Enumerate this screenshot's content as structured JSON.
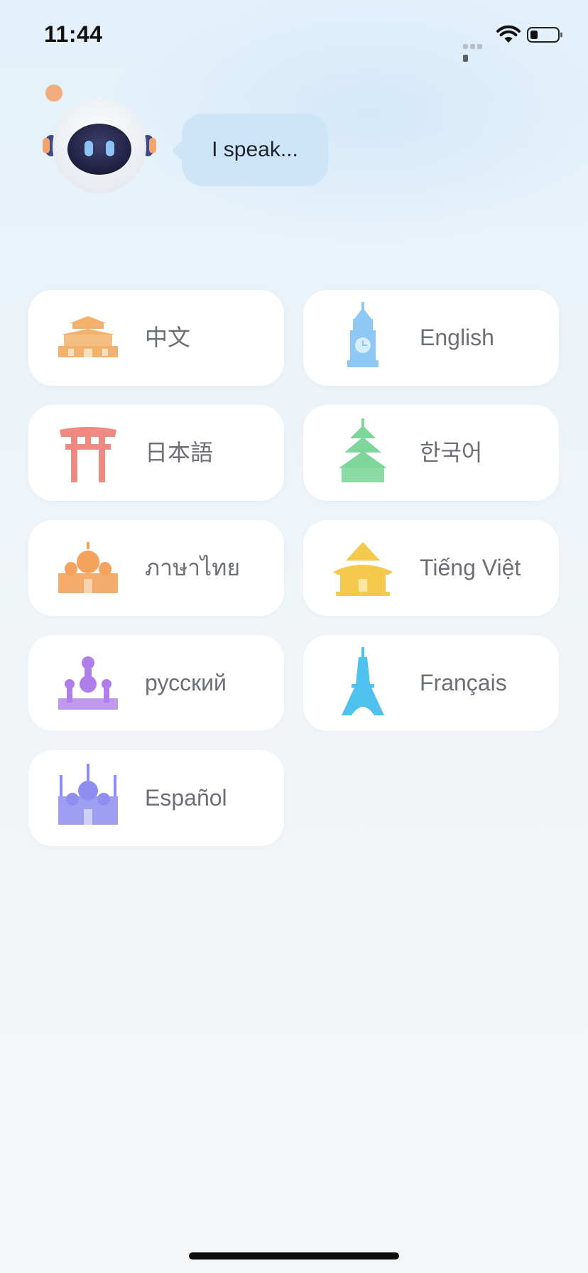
{
  "status_bar": {
    "time": "11:44"
  },
  "header": {
    "bubble_text": "I speak..."
  },
  "languages": [
    {
      "label": "中文",
      "icon": "forbidden-city-icon",
      "color": "#f2b26b"
    },
    {
      "label": "English",
      "icon": "big-ben-icon",
      "color": "#8fc8f4"
    },
    {
      "label": "日本語",
      "icon": "torii-gate-icon",
      "color": "#ee8a82"
    },
    {
      "label": "한국어",
      "icon": "korean-pagoda-icon",
      "color": "#7fd69a"
    },
    {
      "label": "ภาษาไทย",
      "icon": "thai-temple-icon",
      "color": "#f4a25c"
    },
    {
      "label": "Tiếng Việt",
      "icon": "vietnamese-pagoda-icon",
      "color": "#f5c94c"
    },
    {
      "label": "русский",
      "icon": "kremlin-icon",
      "color": "#b07ee8"
    },
    {
      "label": "Français",
      "icon": "eiffel-tower-icon",
      "color": "#4ec1ef"
    },
    {
      "label": "Español",
      "icon": "cathedral-icon",
      "color": "#8d8ef0"
    }
  ],
  "colors": {
    "bubble": "#cde5f6",
    "card": "#ffffff",
    "label_text": "#6c6f74",
    "mascot_accent": "#f3a470"
  }
}
